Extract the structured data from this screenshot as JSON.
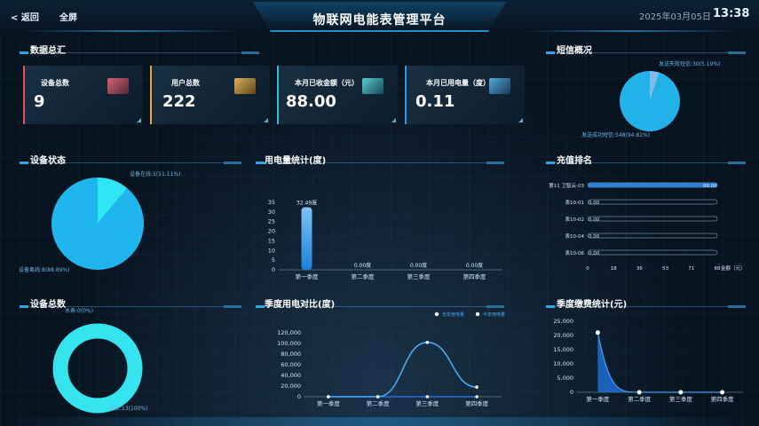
{
  "header": {
    "back_label": "< 返回",
    "fullscreen_label": "全屏",
    "title": "物联网电能表管理平台",
    "date": "2025年03月05日",
    "time": "13:38"
  },
  "panels": {
    "data_summary": "数据总汇",
    "sms": "短信概况",
    "device_status": "设备状态",
    "power_stats": "用电量统计(度)",
    "recharge_rank": "充值排名",
    "device_total": "设备总数",
    "quarter_power": "季度用电对比(度)",
    "quarter_fee": "季度缴费统计(元)"
  },
  "stats": [
    {
      "label": "设备总数",
      "value": "9",
      "color": "#e0525d"
    },
    {
      "label": "用户总数",
      "value": "222",
      "color": "#e6a73c"
    },
    {
      "label": "本月已收金额（元）",
      "value": "88.00",
      "color": "#2fc1d6"
    },
    {
      "label": "本月已用电量（度）",
      "value": "0.11",
      "color": "#2d9ae6"
    }
  ],
  "chart_data": [
    {
      "id": "sms",
      "type": "pie",
      "slices": [
        {
          "label": "发送失败短信:30(5.19%)",
          "value": 30,
          "percent": 5.19,
          "color": "#7fbde6"
        },
        {
          "label": "发送成功短信:548(94.81%)",
          "value": 548,
          "percent": 94.81,
          "color": "#20b2e8"
        }
      ]
    },
    {
      "id": "device_status",
      "type": "pie",
      "slices": [
        {
          "label": "设备在线:1(11.11%)",
          "value": 1,
          "percent": 11.11,
          "color": "#2ee6f6"
        },
        {
          "label": "设备离线:8(88.89%)",
          "value": 8,
          "percent": 88.89,
          "color": "#1fb6ee"
        }
      ]
    },
    {
      "id": "power_stats",
      "type": "bar",
      "categories": [
        "第一季度",
        "第二季度",
        "第三季度",
        "第四季度"
      ],
      "values": [
        32.49,
        0,
        0,
        0
      ],
      "value_labels": [
        "32.49度",
        "0.00度",
        "0.00度",
        "0.00度"
      ],
      "ylim": [
        0,
        35
      ],
      "yticks": [
        "0",
        "5",
        "10",
        "15",
        "20",
        "25",
        "30",
        "35"
      ]
    },
    {
      "id": "recharge_rank",
      "type": "bar",
      "orientation": "horizontal",
      "categories": [
        "第11 卫智云-03",
        "表10-01",
        "表10-02",
        "表10-04",
        "表10-06"
      ],
      "values": [
        88,
        0,
        0,
        0,
        0
      ],
      "value_labels": [
        "88.00",
        "0.00",
        "0.00",
        "0.00",
        "0.00"
      ],
      "xlim": [
        0,
        88
      ],
      "xticks": [
        "0",
        "18",
        "36",
        "53",
        "71",
        "88"
      ],
      "xlabel": "金额（元）"
    },
    {
      "id": "device_total",
      "type": "pie",
      "slices": [
        {
          "label": "水表:0(0%)",
          "value": 0,
          "percent": 0,
          "color": "#1fb6ee"
        },
        {
          "label": "电表:13(100%)",
          "value": 13,
          "percent": 100,
          "color": "#35e4ee"
        }
      ]
    },
    {
      "id": "quarter_power",
      "type": "line",
      "categories": [
        "第一季度",
        "第二季度",
        "第三季度",
        "第四季度"
      ],
      "series": [
        {
          "name": "去年用电量",
          "values": [
            0,
            0,
            0,
            0
          ],
          "color": "#2f6fd6"
        },
        {
          "name": "今年用电量",
          "values": [
            0,
            0,
            102000,
            18000
          ],
          "color": "#4aa6f0"
        }
      ],
      "ylim": [
        0,
        120000
      ],
      "yticks": [
        "0",
        "20,000",
        "40,000",
        "60,000",
        "80,000",
        "100,000",
        "120,000"
      ]
    },
    {
      "id": "quarter_fee",
      "type": "area",
      "categories": [
        "第一季度",
        "第二季度",
        "第三季度",
        "第四季度"
      ],
      "values": [
        21000,
        0,
        0,
        0
      ],
      "ylim": [
        0,
        25000
      ],
      "yticks": [
        "0",
        "5,000",
        "10,000",
        "15,000",
        "20,000",
        "25,000"
      ]
    }
  ]
}
